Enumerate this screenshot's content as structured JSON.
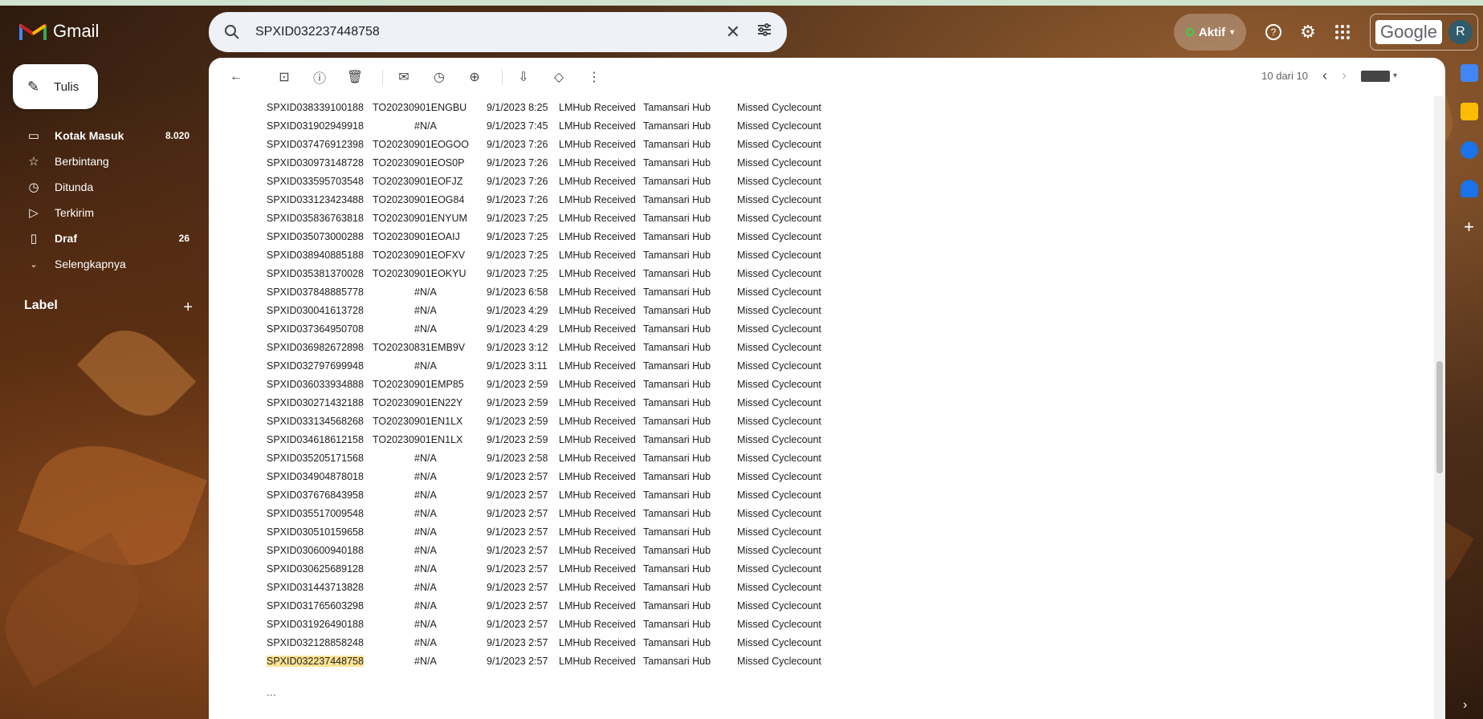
{
  "app": {
    "name": "Gmail"
  },
  "search": {
    "query": "SPXID032237448758"
  },
  "header": {
    "status_label": "Aktif",
    "google_label": "Google",
    "avatar_initial": "R"
  },
  "compose": {
    "label": "Tulis"
  },
  "sidebar": {
    "items": [
      {
        "label": "Kotak Masuk",
        "count": "8.020",
        "icon": "inbox-icon",
        "bold": true
      },
      {
        "label": "Berbintang",
        "count": "",
        "icon": "star-icon",
        "bold": false
      },
      {
        "label": "Ditunda",
        "count": "",
        "icon": "clock-icon",
        "bold": false
      },
      {
        "label": "Terkirim",
        "count": "",
        "icon": "send-icon",
        "bold": false
      },
      {
        "label": "Draf",
        "count": "26",
        "icon": "draft-icon",
        "bold": true
      },
      {
        "label": "Selengkapnya",
        "count": "",
        "icon": "chevron-down-icon",
        "bold": false
      }
    ],
    "label_header": "Label"
  },
  "pager": {
    "text": "10 dari 10"
  },
  "rows": [
    [
      "SPXID038339100188",
      "TO20230901ENGBU",
      "9/1/2023 8:25",
      "LMHub Received",
      "Tamansari Hub",
      "Missed Cyclecount"
    ],
    [
      "SPXID031902949918",
      "#N/A",
      "9/1/2023 7:45",
      "LMHub Received",
      "Tamansari Hub",
      "Missed Cyclecount"
    ],
    [
      "SPXID037476912398",
      "TO20230901EOGOO",
      "9/1/2023 7:26",
      "LMHub Received",
      "Tamansari Hub",
      "Missed Cyclecount"
    ],
    [
      "SPXID030973148728",
      "TO20230901EOS0P",
      "9/1/2023 7:26",
      "LMHub Received",
      "Tamansari Hub",
      "Missed Cyclecount"
    ],
    [
      "SPXID033595703548",
      "TO20230901EOFJZ",
      "9/1/2023 7:26",
      "LMHub Received",
      "Tamansari Hub",
      "Missed Cyclecount"
    ],
    [
      "SPXID033123423488",
      "TO20230901EOG84",
      "9/1/2023 7:26",
      "LMHub Received",
      "Tamansari Hub",
      "Missed Cyclecount"
    ],
    [
      "SPXID035836763818",
      "TO20230901ENYUM",
      "9/1/2023 7:25",
      "LMHub Received",
      "Tamansari Hub",
      "Missed Cyclecount"
    ],
    [
      "SPXID035073000288",
      "TO20230901EOAIJ",
      "9/1/2023 7:25",
      "LMHub Received",
      "Tamansari Hub",
      "Missed Cyclecount"
    ],
    [
      "SPXID038940885188",
      "TO20230901EOFXV",
      "9/1/2023 7:25",
      "LMHub Received",
      "Tamansari Hub",
      "Missed Cyclecount"
    ],
    [
      "SPXID035381370028",
      "TO20230901EOKYU",
      "9/1/2023 7:25",
      "LMHub Received",
      "Tamansari Hub",
      "Missed Cyclecount"
    ],
    [
      "SPXID037848885778",
      "#N/A",
      "9/1/2023 6:58",
      "LMHub Received",
      "Tamansari Hub",
      "Missed Cyclecount"
    ],
    [
      "SPXID030041613728",
      "#N/A",
      "9/1/2023 4:29",
      "LMHub Received",
      "Tamansari Hub",
      "Missed Cyclecount"
    ],
    [
      "SPXID037364950708",
      "#N/A",
      "9/1/2023 4:29",
      "LMHub Received",
      "Tamansari Hub",
      "Missed Cyclecount"
    ],
    [
      "SPXID036982672898",
      "TO20230831EMB9V",
      "9/1/2023 3:12",
      "LMHub Received",
      "Tamansari Hub",
      "Missed Cyclecount"
    ],
    [
      "SPXID032797699948",
      "#N/A",
      "9/1/2023 3:11",
      "LMHub Received",
      "Tamansari Hub",
      "Missed Cyclecount"
    ],
    [
      "SPXID036033934888",
      "TO20230901EMP85",
      "9/1/2023 2:59",
      "LMHub Received",
      "Tamansari Hub",
      "Missed Cyclecount"
    ],
    [
      "SPXID030271432188",
      "TO20230901EN22Y",
      "9/1/2023 2:59",
      "LMHub Received",
      "Tamansari Hub",
      "Missed Cyclecount"
    ],
    [
      "SPXID033134568268",
      "TO20230901EN1LX",
      "9/1/2023 2:59",
      "LMHub Received",
      "Tamansari Hub",
      "Missed Cyclecount"
    ],
    [
      "SPXID034618612158",
      "TO20230901EN1LX",
      "9/1/2023 2:59",
      "LMHub Received",
      "Tamansari Hub",
      "Missed Cyclecount"
    ],
    [
      "SPXID035205171568",
      "#N/A",
      "9/1/2023 2:58",
      "LMHub Received",
      "Tamansari Hub",
      "Missed Cyclecount"
    ],
    [
      "SPXID034904878018",
      "#N/A",
      "9/1/2023 2:57",
      "LMHub Received",
      "Tamansari Hub",
      "Missed Cyclecount"
    ],
    [
      "SPXID037676843958",
      "#N/A",
      "9/1/2023 2:57",
      "LMHub Received",
      "Tamansari Hub",
      "Missed Cyclecount"
    ],
    [
      "SPXID035517009548",
      "#N/A",
      "9/1/2023 2:57",
      "LMHub Received",
      "Tamansari Hub",
      "Missed Cyclecount"
    ],
    [
      "SPXID030510159658",
      "#N/A",
      "9/1/2023 2:57",
      "LMHub Received",
      "Tamansari Hub",
      "Missed Cyclecount"
    ],
    [
      "SPXID030600940188",
      "#N/A",
      "9/1/2023 2:57",
      "LMHub Received",
      "Tamansari Hub",
      "Missed Cyclecount"
    ],
    [
      "SPXID030625689128",
      "#N/A",
      "9/1/2023 2:57",
      "LMHub Received",
      "Tamansari Hub",
      "Missed Cyclecount"
    ],
    [
      "SPXID031443713828",
      "#N/A",
      "9/1/2023 2:57",
      "LMHub Received",
      "Tamansari Hub",
      "Missed Cyclecount"
    ],
    [
      "SPXID031765603298",
      "#N/A",
      "9/1/2023 2:57",
      "LMHub Received",
      "Tamansari Hub",
      "Missed Cyclecount"
    ],
    [
      "SPXID031926490188",
      "#N/A",
      "9/1/2023 2:57",
      "LMHub Received",
      "Tamansari Hub",
      "Missed Cyclecount"
    ],
    [
      "SPXID032128858248",
      "#N/A",
      "9/1/2023 2:57",
      "LMHub Received",
      "Tamansari Hub",
      "Missed Cyclecount"
    ],
    [
      "SPXID032237448758",
      "#N/A",
      "9/1/2023 2:57",
      "LMHub Received",
      "Tamansari Hub",
      "Missed Cyclecount"
    ]
  ],
  "highlighted_row_index": 30,
  "trailing_text": "...",
  "colors": {
    "highlight": "#fde293",
    "status_dot": "#37d24b"
  }
}
